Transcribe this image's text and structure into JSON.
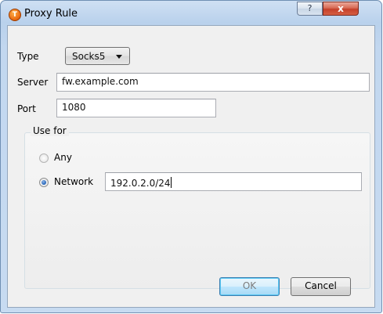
{
  "window": {
    "title": "Proxy Rule",
    "app_icon_glyph": "T",
    "help_label": "?",
    "close_label": "x"
  },
  "form": {
    "type_label": "Type",
    "type_value": "Socks5",
    "server_label": "Server",
    "server_value": "fw.example.com",
    "port_label": "Port",
    "port_value": "1080"
  },
  "use_for": {
    "title": "Use for",
    "options": [
      {
        "label": "Any",
        "checked": false
      },
      {
        "label": "Network",
        "checked": true
      }
    ],
    "network_value": "192.0.2.0/24"
  },
  "buttons": {
    "ok_label": "OK",
    "cancel_label": "Cancel"
  },
  "colors": {
    "title_bar": "#c2d7ef",
    "close_button": "#c5402a",
    "dialog_bg": "#f0f0f0"
  },
  "icons": [
    "app-logo-icon",
    "help-icon",
    "close-icon",
    "dropdown-arrow-icon"
  ]
}
